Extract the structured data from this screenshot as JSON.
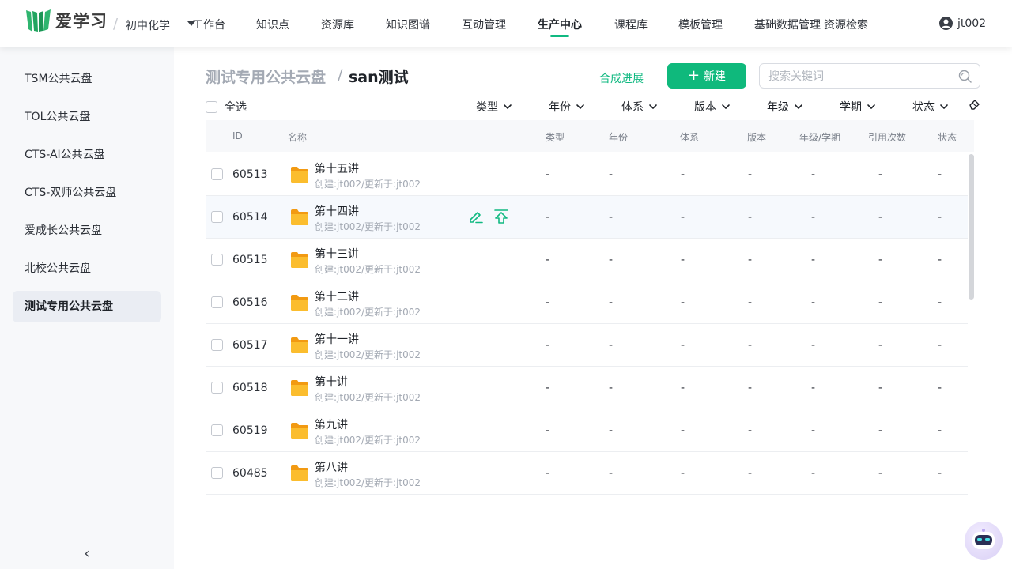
{
  "header": {
    "logo_text": "爱学习",
    "subject": "初中化学",
    "nav": [
      {
        "label": "工作台"
      },
      {
        "label": "知识点"
      },
      {
        "label": "资源库"
      },
      {
        "label": "知识图谱"
      },
      {
        "label": "互动管理"
      },
      {
        "label": "生产中心",
        "active": true
      },
      {
        "label": "课程库"
      },
      {
        "label": "模板管理"
      },
      {
        "label": "基础数据管理"
      },
      {
        "label": "资源检索"
      }
    ],
    "username": "jt002"
  },
  "sidebar": {
    "items": [
      {
        "label": "TSM公共云盘"
      },
      {
        "label": "TOL公共云盘"
      },
      {
        "label": "CTS-AI公共云盘"
      },
      {
        "label": "CTS-双师公共云盘"
      },
      {
        "label": "爱成长公共云盘"
      },
      {
        "label": "北校公共云盘"
      },
      {
        "label": "测试专用公共云盘",
        "active": true
      }
    ],
    "collapse_glyph": "‹"
  },
  "breadcrumb": {
    "root": "测试专用公共云盘",
    "separator": "/",
    "current": "san测试"
  },
  "toolbar": {
    "progress_link": "合成进展",
    "new_button": "新建",
    "search_placeholder": "搜索关键词",
    "select_all": "全选"
  },
  "filters": [
    "类型",
    "年份",
    "体系",
    "版本",
    "年级",
    "学期",
    "状态"
  ],
  "table": {
    "columns": [
      "ID",
      "名称",
      "类型",
      "年份",
      "体系",
      "版本",
      "年级/学期",
      "引用次数",
      "状态"
    ],
    "rows": [
      {
        "id": "60513",
        "name": "第十五讲",
        "meta": "创建:jt002/更新于:jt002",
        "cells": [
          "-",
          "-",
          "-",
          "-",
          "-",
          "-",
          "-"
        ]
      },
      {
        "id": "60514",
        "name": "第十四讲",
        "meta": "创建:jt002/更新于:jt002",
        "cells": [
          "-",
          "-",
          "-",
          "-",
          "-",
          "-",
          "-"
        ],
        "hover": true
      },
      {
        "id": "60515",
        "name": "第十三讲",
        "meta": "创建:jt002/更新于:jt002",
        "cells": [
          "-",
          "-",
          "-",
          "-",
          "-",
          "-",
          "-"
        ]
      },
      {
        "id": "60516",
        "name": "第十二讲",
        "meta": "创建:jt002/更新于:jt002",
        "cells": [
          "-",
          "-",
          "-",
          "-",
          "-",
          "-",
          "-"
        ]
      },
      {
        "id": "60517",
        "name": "第十一讲",
        "meta": "创建:jt002/更新于:jt002",
        "cells": [
          "-",
          "-",
          "-",
          "-",
          "-",
          "-",
          "-"
        ]
      },
      {
        "id": "60518",
        "name": "第十讲",
        "meta": "创建:jt002/更新于:jt002",
        "cells": [
          "-",
          "-",
          "-",
          "-",
          "-",
          "-",
          "-"
        ]
      },
      {
        "id": "60519",
        "name": "第九讲",
        "meta": "创建:jt002/更新于:jt002",
        "cells": [
          "-",
          "-",
          "-",
          "-",
          "-",
          "-",
          "-"
        ]
      },
      {
        "id": "60485",
        "name": "第八讲",
        "meta": "创建:jt002/更新于:jt002",
        "cells": [
          "-",
          "-",
          "-",
          "-",
          "-",
          "-",
          "-"
        ]
      }
    ]
  },
  "colors": {
    "accent": "#10b981",
    "folder": "#f5a623"
  }
}
